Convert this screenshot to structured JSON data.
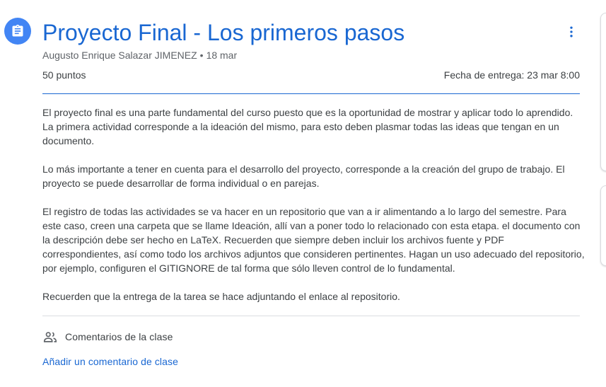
{
  "assignment": {
    "title": "Proyecto Final - Los primeros pasos",
    "author": "Augusto Enrique Salazar JIMENEZ",
    "separator": "•",
    "date": "18 mar",
    "points": "50 puntos",
    "due": "Fecha de entrega: 23 mar 8:00",
    "paragraphs": [
      "El proyecto final es una parte fundamental del curso puesto que es la oportunidad de mostrar y aplicar todo lo aprendido. La primera actividad corresponde a la ideación del mismo, para esto deben plasmar todas las ideas que tengan en un documento.",
      "Lo más importante a tener en cuenta para el desarrollo del proyecto, corresponde a la creación del grupo de trabajo. El proyecto se puede desarrollar de forma individual o en parejas.",
      "El registro de todas las actividades se va hacer en un repositorio que van a ir alimentando a lo largo del semestre. Para este caso, creen una carpeta que se llame Ideación, allí van a poner todo lo relacionado con esta etapa. el documento con la descripción debe ser hecho en LaTeX. Recuerden que siempre deben incluir los archivos fuente y PDF correspondientes, así como todo los archivos adjuntos que consideren pertinentes. Hagan un uso adecuado del repositorio, por ejemplo, configuren el GITIGNORE de tal forma que sólo lleven control de lo fundamental.",
      "Recuerden que la entrega de la tarea se hace adjuntando el enlace al repositorio."
    ]
  },
  "comments": {
    "header": "Comentarios de la clase",
    "add_label": "Añadir un comentario de clase"
  },
  "icons": {
    "assignment": "assignment-icon",
    "more": "more-vert-icon",
    "people": "people-icon"
  },
  "colors": {
    "accent": "#1967d2",
    "icon_bg": "#4285f4",
    "text": "#3c4043",
    "muted": "#5f6368"
  }
}
